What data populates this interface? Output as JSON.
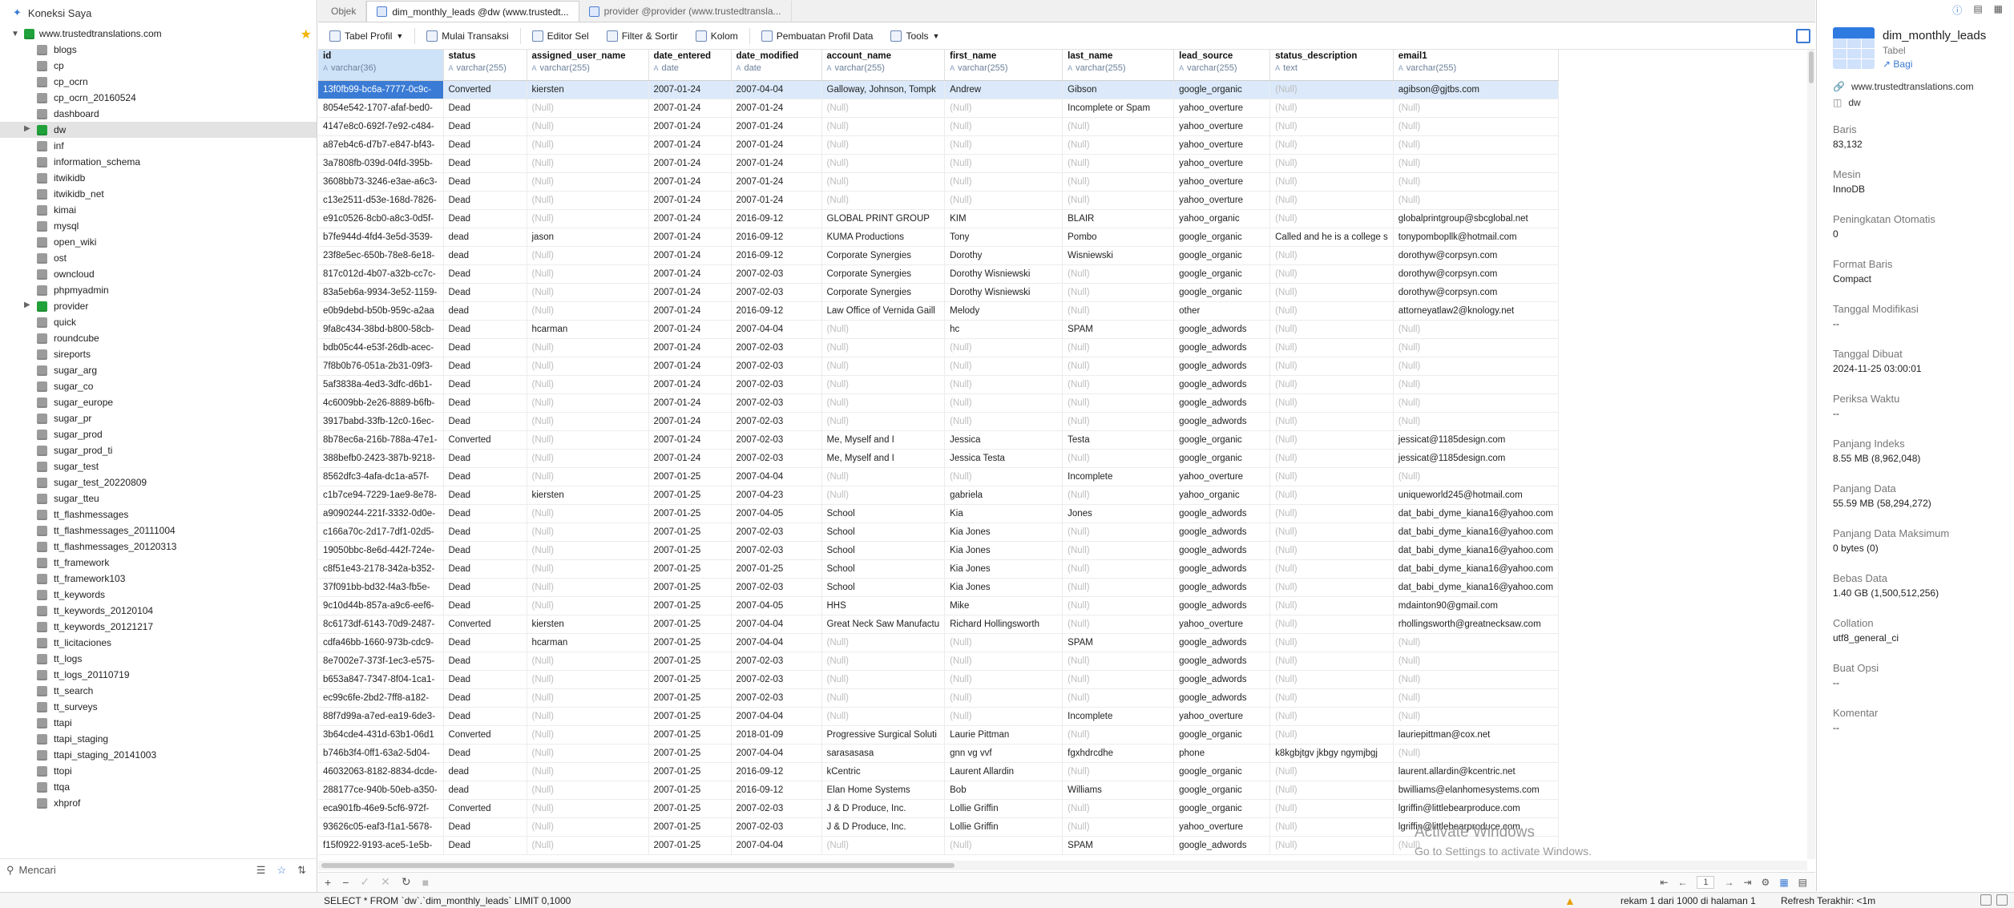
{
  "sidebar": {
    "title": "Koneksi Saya",
    "connection": "www.trustedtranslations.com",
    "search_placeholder": "Mencari",
    "databases": [
      {
        "name": "blogs"
      },
      {
        "name": "cp"
      },
      {
        "name": "cp_ocrn"
      },
      {
        "name": "cp_ocrn_20160524"
      },
      {
        "name": "dashboard"
      },
      {
        "name": "dw",
        "green": true,
        "selected": true,
        "expandable": true
      },
      {
        "name": "inf"
      },
      {
        "name": "information_schema"
      },
      {
        "name": "itwikidb"
      },
      {
        "name": "itwikidb_net"
      },
      {
        "name": "kimai"
      },
      {
        "name": "mysql"
      },
      {
        "name": "open_wiki"
      },
      {
        "name": "ost"
      },
      {
        "name": "owncloud"
      },
      {
        "name": "phpmyadmin"
      },
      {
        "name": "provider",
        "green": true,
        "expandable": true
      },
      {
        "name": "quick"
      },
      {
        "name": "roundcube"
      },
      {
        "name": "sireports"
      },
      {
        "name": "sugar_arg"
      },
      {
        "name": "sugar_co"
      },
      {
        "name": "sugar_europe"
      },
      {
        "name": "sugar_pr"
      },
      {
        "name": "sugar_prod"
      },
      {
        "name": "sugar_prod_ti"
      },
      {
        "name": "sugar_test"
      },
      {
        "name": "sugar_test_20220809"
      },
      {
        "name": "sugar_tteu"
      },
      {
        "name": "tt_flashmessages"
      },
      {
        "name": "tt_flashmessages_20111004"
      },
      {
        "name": "tt_flashmessages_20120313"
      },
      {
        "name": "tt_framework"
      },
      {
        "name": "tt_framework103"
      },
      {
        "name": "tt_keywords"
      },
      {
        "name": "tt_keywords_20120104"
      },
      {
        "name": "tt_keywords_20121217"
      },
      {
        "name": "tt_licitaciones"
      },
      {
        "name": "tt_logs"
      },
      {
        "name": "tt_logs_20110719"
      },
      {
        "name": "tt_search"
      },
      {
        "name": "tt_surveys"
      },
      {
        "name": "ttapi"
      },
      {
        "name": "ttapi_staging"
      },
      {
        "name": "ttapi_staging_20141003"
      },
      {
        "name": "ttopi"
      },
      {
        "name": "ttqa"
      },
      {
        "name": "xhprof"
      }
    ]
  },
  "tabs": [
    {
      "label": "Objek"
    },
    {
      "label": "dim_monthly_leads @dw (www.trustedt...",
      "active": true
    },
    {
      "label": "provider @provider (www.trustedtransla..."
    }
  ],
  "toolbar": {
    "table_profile": "Tabel Profil",
    "begin_transaction": "Mulai Transaksi",
    "text_editor": "Editor Sel",
    "filter_sort": "Filter & Sortir",
    "columns": "Kolom",
    "data_profiling": "Pembuatan Profil Data",
    "tools": "Tools"
  },
  "grid": {
    "null_text": "(Null)",
    "columns": [
      {
        "name": "id",
        "type": "varchar(36)",
        "w": 156,
        "sel": true
      },
      {
        "name": "status",
        "type": "varchar(255)",
        "w": 104
      },
      {
        "name": "assigned_user_name",
        "type": "varchar(255)",
        "w": 152
      },
      {
        "name": "date_entered",
        "type": "date",
        "w": 103
      },
      {
        "name": "date_modified",
        "type": "date",
        "w": 113
      },
      {
        "name": "account_name",
        "type": "varchar(255)",
        "w": 150
      },
      {
        "name": "first_name",
        "type": "varchar(255)",
        "w": 147
      },
      {
        "name": "last_name",
        "type": "varchar(255)",
        "w": 139
      },
      {
        "name": "lead_source",
        "type": "varchar(255)",
        "w": 120
      },
      {
        "name": "status_description",
        "type": "text",
        "w": 149
      },
      {
        "name": "email1",
        "type": "varchar(255)",
        "w": 200
      }
    ],
    "rows": [
      [
        "13f0fb99-bc6a-7777-0c9c-",
        "Converted",
        "kiersten",
        "2007-01-24",
        "2007-04-04",
        "Galloway, Johnson, Tompk",
        "Andrew",
        "Gibson",
        "google_organic",
        null,
        "agibson@gjtbs.com"
      ],
      [
        "8054e542-1707-afaf-bed0-",
        "Dead",
        null,
        "2007-01-24",
        "2007-01-24",
        null,
        null,
        "Incomplete or Spam",
        "yahoo_overture",
        null,
        null
      ],
      [
        "4147e8c0-692f-7e92-c484-",
        "Dead",
        null,
        "2007-01-24",
        "2007-01-24",
        null,
        null,
        null,
        "yahoo_overture",
        null,
        null
      ],
      [
        "a87eb4c6-d7b7-e847-bf43-",
        "Dead",
        null,
        "2007-01-24",
        "2007-01-24",
        null,
        null,
        null,
        "yahoo_overture",
        null,
        null
      ],
      [
        "3a7808fb-039d-04fd-395b-",
        "Dead",
        null,
        "2007-01-24",
        "2007-01-24",
        null,
        null,
        null,
        "yahoo_overture",
        null,
        null
      ],
      [
        "3608bb73-3246-e3ae-a6c3-",
        "Dead",
        null,
        "2007-01-24",
        "2007-01-24",
        null,
        null,
        null,
        "yahoo_overture",
        null,
        null
      ],
      [
        "c13e2511-d53e-168d-7826-",
        "Dead",
        null,
        "2007-01-24",
        "2007-01-24",
        null,
        null,
        null,
        "yahoo_overture",
        null,
        null
      ],
      [
        "e91c0526-8cb0-a8c3-0d5f-",
        "Dead",
        null,
        "2007-01-24",
        "2016-09-12",
        "GLOBAL PRINT GROUP",
        "KIM",
        "BLAIR",
        "yahoo_organic",
        null,
        "globalprintgroup@sbcglobal.net"
      ],
      [
        "b7fe944d-4fd4-3e5d-3539-",
        "dead",
        "jason",
        "2007-01-24",
        "2016-09-12",
        "KUMA Productions",
        "Tony",
        "Pombo",
        "google_organic",
        "Called and he is a college s",
        "tonypombopllk@hotmail.com"
      ],
      [
        "23f8e5ec-650b-78e8-6e18-",
        "dead",
        null,
        "2007-01-24",
        "2016-09-12",
        "Corporate Synergies",
        "Dorothy",
        "Wisniewski",
        "google_organic",
        null,
        "dorothyw@corpsyn.com"
      ],
      [
        "817c012d-4b07-a32b-cc7c-",
        "Dead",
        null,
        "2007-01-24",
        "2007-02-03",
        "Corporate Synergies",
        "Dorothy Wisniewski",
        null,
        "google_organic",
        null,
        "dorothyw@corpsyn.com"
      ],
      [
        "83a5eb6a-9934-3e52-1159-",
        "Dead",
        null,
        "2007-01-24",
        "2007-02-03",
        "Corporate Synergies",
        "Dorothy Wisniewski",
        null,
        "google_organic",
        null,
        "dorothyw@corpsyn.com"
      ],
      [
        "e0b9debd-b50b-959c-a2aa",
        "dead",
        null,
        "2007-01-24",
        "2016-09-12",
        "Law Office of Vernida Gaill",
        "Melody",
        null,
        "other",
        null,
        "attorneyatlaw2@knology.net"
      ],
      [
        "9fa8c434-38bd-b800-58cb-",
        "Dead",
        "hcarman",
        "2007-01-24",
        "2007-04-04",
        null,
        "hc",
        "SPAM",
        "google_adwords",
        null,
        null
      ],
      [
        "bdb05c44-e53f-26db-acec-",
        "Dead",
        null,
        "2007-01-24",
        "2007-02-03",
        null,
        null,
        null,
        "google_adwords",
        null,
        null
      ],
      [
        "7f8b0b76-051a-2b31-09f3-",
        "Dead",
        null,
        "2007-01-24",
        "2007-02-03",
        null,
        null,
        null,
        "google_adwords",
        null,
        null
      ],
      [
        "5af3838a-4ed3-3dfc-d6b1-",
        "Dead",
        null,
        "2007-01-24",
        "2007-02-03",
        null,
        null,
        null,
        "google_adwords",
        null,
        null
      ],
      [
        "4c6009bb-2e26-8889-b6fb-",
        "Dead",
        null,
        "2007-01-24",
        "2007-02-03",
        null,
        null,
        null,
        "google_adwords",
        null,
        null
      ],
      [
        "3917babd-33fb-12c0-16ec-",
        "Dead",
        null,
        "2007-01-24",
        "2007-02-03",
        null,
        null,
        null,
        "google_adwords",
        null,
        null
      ],
      [
        "8b78ec6a-216b-788a-47e1-",
        "Converted",
        null,
        "2007-01-24",
        "2007-02-03",
        "Me, Myself and I",
        "Jessica",
        "Testa",
        "google_organic",
        null,
        "jessicat@1185design.com"
      ],
      [
        "388befb0-2423-387b-9218-",
        "Dead",
        null,
        "2007-01-24",
        "2007-02-03",
        "Me, Myself and I",
        "Jessica Testa",
        null,
        "google_organic",
        null,
        "jessicat@1185design.com"
      ],
      [
        "8562dfc3-4afa-dc1a-a57f-",
        "Dead",
        null,
        "2007-01-25",
        "2007-04-04",
        null,
        null,
        "Incomplete",
        "yahoo_overture",
        null,
        null
      ],
      [
        "c1b7ce94-7229-1ae9-8e78-",
        "Dead",
        "kiersten",
        "2007-01-25",
        "2007-04-23",
        null,
        "gabriela",
        null,
        "yahoo_organic",
        null,
        "uniqueworld245@hotmail.com"
      ],
      [
        "a9090244-221f-3332-0d0e-",
        "Dead",
        null,
        "2007-01-25",
        "2007-04-05",
        "School",
        "Kia",
        "Jones",
        "google_adwords",
        null,
        "dat_babi_dyme_kiana16@yahoo.com"
      ],
      [
        "c166a70c-2d17-7df1-02d5-",
        "Dead",
        null,
        "2007-01-25",
        "2007-02-03",
        "School",
        "Kia Jones",
        null,
        "google_adwords",
        null,
        "dat_babi_dyme_kiana16@yahoo.com"
      ],
      [
        "19050bbc-8e6d-442f-724e-",
        "Dead",
        null,
        "2007-01-25",
        "2007-02-03",
        "School",
        "Kia Jones",
        null,
        "google_adwords",
        null,
        "dat_babi_dyme_kiana16@yahoo.com"
      ],
      [
        "c8f51e43-2178-342a-b352-",
        "Dead",
        null,
        "2007-01-25",
        "2007-01-25",
        "School",
        "Kia Jones",
        null,
        "google_adwords",
        null,
        "dat_babi_dyme_kiana16@yahoo.com"
      ],
      [
        "37f091bb-bd32-f4a3-fb5e-",
        "Dead",
        null,
        "2007-01-25",
        "2007-02-03",
        "School",
        "Kia Jones",
        null,
        "google_adwords",
        null,
        "dat_babi_dyme_kiana16@yahoo.com"
      ],
      [
        "9c10d44b-857a-a9c6-eef6-",
        "Dead",
        null,
        "2007-01-25",
        "2007-04-05",
        "HHS",
        "Mike",
        null,
        "google_adwords",
        null,
        "mdainton90@gmail.com"
      ],
      [
        "8c6173df-6143-70d9-2487-",
        "Converted",
        "kiersten",
        "2007-01-25",
        "2007-04-04",
        "Great Neck Saw Manufactu",
        "Richard Hollingsworth",
        null,
        "yahoo_overture",
        null,
        "rhollingsworth@greatnecksaw.com"
      ],
      [
        "cdfa46bb-1660-973b-cdc9-",
        "Dead",
        "hcarman",
        "2007-01-25",
        "2007-04-04",
        null,
        null,
        "SPAM",
        "google_adwords",
        null,
        null
      ],
      [
        "8e7002e7-373f-1ec3-e575-",
        "Dead",
        null,
        "2007-01-25",
        "2007-02-03",
        null,
        null,
        null,
        "google_adwords",
        null,
        null
      ],
      [
        "b653a847-7347-8f04-1ca1-",
        "Dead",
        null,
        "2007-01-25",
        "2007-02-03",
        null,
        null,
        null,
        "google_adwords",
        null,
        null
      ],
      [
        "ec99c6fe-2bd2-7ff8-a182-",
        "Dead",
        null,
        "2007-01-25",
        "2007-02-03",
        null,
        null,
        null,
        "google_adwords",
        null,
        null
      ],
      [
        "88f7d99a-a7ed-ea19-6de3-",
        "Dead",
        null,
        "2007-01-25",
        "2007-04-04",
        null,
        null,
        "Incomplete",
        "yahoo_overture",
        null,
        null
      ],
      [
        "3b64cde4-431d-63b1-06d1",
        "Converted",
        null,
        "2007-01-25",
        "2018-01-09",
        "Progressive Surgical Soluti",
        "Laurie Pittman",
        null,
        "google_organic",
        null,
        "lauriepittman@cox.net"
      ],
      [
        "b746b3f4-0ff1-63a2-5d04-",
        "Dead",
        null,
        "2007-01-25",
        "2007-04-04",
        "sarasasasa",
        "gnn vg vvf",
        "fgxhdrcdhe",
        "phone",
        "k8kgbjtgv jkbgy ngymjbgj",
        null
      ],
      [
        "46032063-8182-8834-dcde-",
        "dead",
        null,
        "2007-01-25",
        "2016-09-12",
        "kCentric",
        "Laurent Allardin",
        null,
        "google_organic",
        null,
        "laurent.allardin@kcentric.net"
      ],
      [
        "288177ce-940b-50eb-a350-",
        "dead",
        null,
        "2007-01-25",
        "2016-09-12",
        "Elan Home Systems",
        "Bob",
        "Williams",
        "google_organic",
        null,
        "bwilliams@elanhomesystems.com"
      ],
      [
        "eca901fb-46e9-5cf6-972f-",
        "Converted",
        null,
        "2007-01-25",
        "2007-02-03",
        "J & D Produce, Inc.",
        "Lollie Griffin",
        null,
        "google_organic",
        null,
        "lgriffin@littlebearproduce.com"
      ],
      [
        "93626c05-eaf3-f1a1-5678-",
        "Dead",
        null,
        "2007-01-25",
        "2007-02-03",
        "J & D Produce, Inc.",
        "Lollie Griffin",
        null,
        "yahoo_overture",
        null,
        "lgriffin@littlebearproduce.com"
      ],
      [
        "f15f0922-9193-ace5-1e5b-",
        "Dead",
        null,
        "2007-01-25",
        "2007-04-04",
        null,
        null,
        "SPAM",
        "google_adwords",
        null,
        null
      ]
    ]
  },
  "bottom": {
    "page": "1"
  },
  "watermark": {
    "line1": "Activate Windows",
    "line2": "Go to Settings to activate Windows."
  },
  "status": {
    "sql": "SELECT * FROM `dw`.`dim_monthly_leads` LIMIT 0,1000",
    "records": "rekam 1 dari 1000 di halaman 1",
    "refresh": "Refresh Terakhir: <1m"
  },
  "info": {
    "name": "dim_monthly_leads",
    "kind": "Tabel",
    "share": "Bagi",
    "host": "www.trustedtranslations.com",
    "db": "dw",
    "fields": [
      {
        "label": "Baris",
        "value": "83,132"
      },
      {
        "label": "Mesin",
        "value": "InnoDB"
      },
      {
        "label": "Peningkatan Otomatis",
        "value": "0"
      },
      {
        "label": "Format Baris",
        "value": "Compact"
      },
      {
        "label": "Tanggal Modifikasi",
        "value": "--"
      },
      {
        "label": "Tanggal Dibuat",
        "value": "2024-11-25 03:00:01"
      },
      {
        "label": "Periksa Waktu",
        "value": "--"
      },
      {
        "label": "Panjang Indeks",
        "value": "8.55 MB (8,962,048)"
      },
      {
        "label": "Panjang Data",
        "value": "55.59 MB (58,294,272)"
      },
      {
        "label": "Panjang Data Maksimum",
        "value": "0 bytes (0)"
      },
      {
        "label": "Bebas Data",
        "value": "1.40 GB (1,500,512,256)"
      },
      {
        "label": "Collation",
        "value": "utf8_general_ci"
      },
      {
        "label": "Buat Opsi",
        "value": "--"
      },
      {
        "label": "Komentar",
        "value": "--"
      }
    ]
  },
  "colors": {
    "accent": "#3a7bd5",
    "selection": "#dbe9fa",
    "db_active": "#21a139",
    "star": "#f3b400"
  }
}
